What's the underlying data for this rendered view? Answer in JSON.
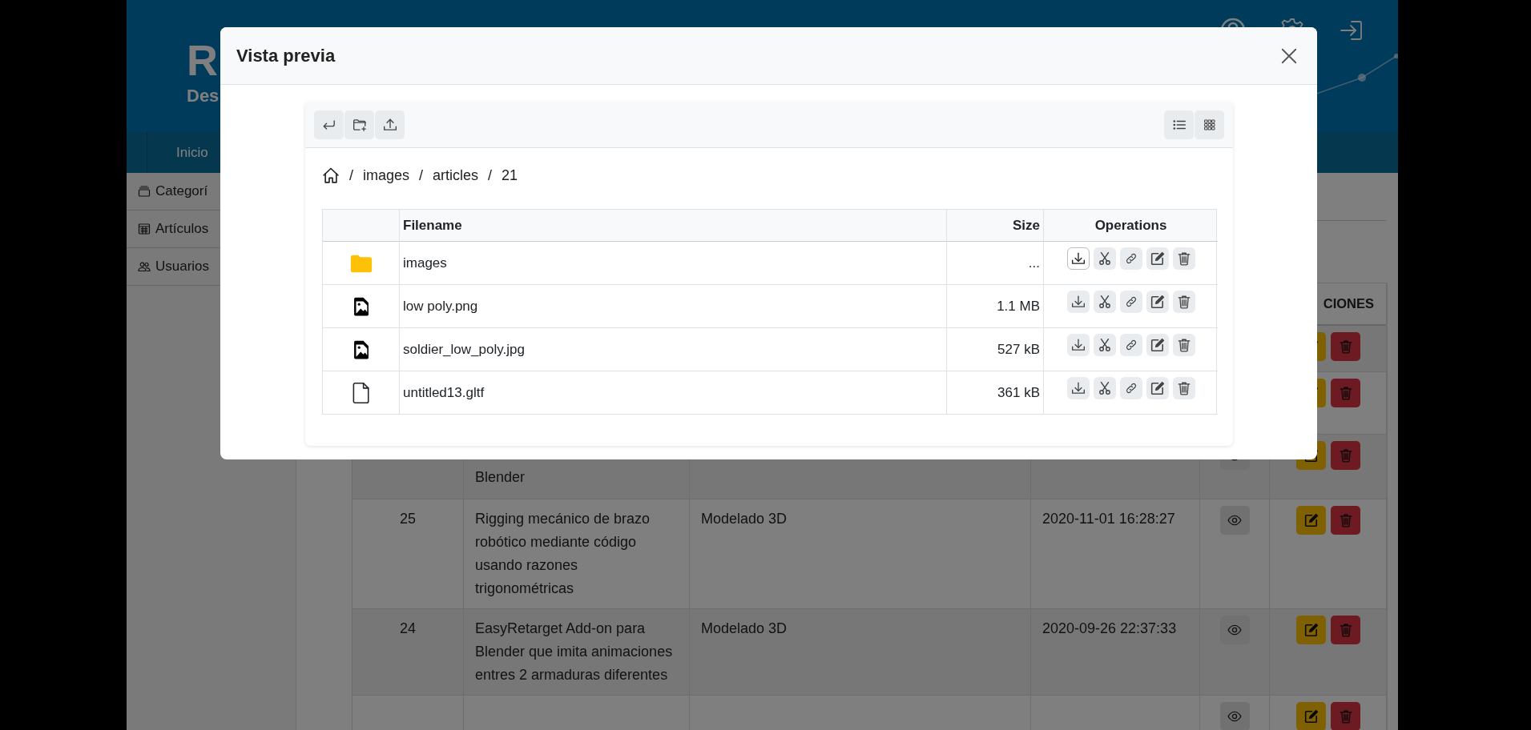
{
  "header": {
    "logo": "R",
    "subtitle": "Des"
  },
  "nav": [
    "Inicio"
  ],
  "sidebar": {
    "items": [
      "Categorí",
      "Artículos",
      "Usuarios"
    ]
  },
  "articles_table": {
    "header_partial": "CIONES",
    "rows": [
      {},
      {},
      {
        "title": "Blender",
        "view": true,
        "clipped_top": true
      },
      {
        "id": "25",
        "title": "Rigging mecánico de brazo robótico mediante código usando razones trigonométricas",
        "category": "Modelado 3D",
        "date": "2020-11-01 16:28:27",
        "view": true,
        "clipped_top": false
      },
      {
        "id": "24",
        "title": "EasyRetarget Add-on para Blender que imita animaciones entres 2 armaduras diferentes",
        "category": "Modelado 3D",
        "date": "2020-09-26 22:37:33",
        "view": true,
        "clipped_top": false
      },
      {
        "view": true,
        "clipped_top": false
      }
    ]
  },
  "modal": {
    "title": "Vista previa",
    "breadcrumb": {
      "separator": "/",
      "parts": [
        "images",
        "articles",
        "21"
      ]
    },
    "files": {
      "columns": [
        "Filename",
        "Size",
        "Operations"
      ],
      "rows": [
        {
          "kind": "folder",
          "name": "images",
          "size": "...",
          "download_hovered": true
        },
        {
          "kind": "image",
          "name": "low poly.png",
          "size": "1.1 MB",
          "download_hovered": false
        },
        {
          "kind": "image",
          "name": "soldier_low_poly.jpg",
          "size": "527 kB",
          "download_hovered": false
        },
        {
          "kind": "file",
          "name": "untitled13.gltf",
          "size": "361 kB",
          "download_hovered": false
        }
      ]
    }
  }
}
